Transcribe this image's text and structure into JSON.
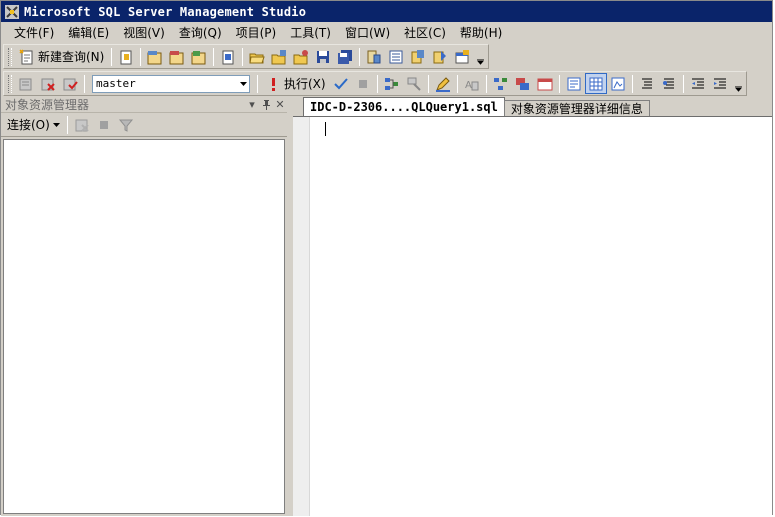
{
  "window": {
    "title": "Microsoft SQL Server Management Studio"
  },
  "menu": [
    {
      "label": "文件(F)",
      "name": "menu-file"
    },
    {
      "label": "编辑(E)",
      "name": "menu-edit"
    },
    {
      "label": "视图(V)",
      "name": "menu-view"
    },
    {
      "label": "查询(Q)",
      "name": "menu-query"
    },
    {
      "label": "项目(P)",
      "name": "menu-project"
    },
    {
      "label": "工具(T)",
      "name": "menu-tools"
    },
    {
      "label": "窗口(W)",
      "name": "menu-window"
    },
    {
      "label": "社区(C)",
      "name": "menu-community"
    },
    {
      "label": "帮助(H)",
      "name": "menu-help"
    }
  ],
  "toolbar1": {
    "new_query_label": "新建查询(N)"
  },
  "toolbar2": {
    "database": "master",
    "execute_label": "执行(X)"
  },
  "object_explorer": {
    "title": "对象资源管理器",
    "connect_label": "连接(O)",
    "pin_glyph": "ᵖ",
    "close_glyph": "✕",
    "dropdown_glyph": "▾"
  },
  "tabs": [
    {
      "label": "IDC-D-2306....QLQuery1.sql",
      "active": true
    },
    {
      "label": "对象资源管理器详细信息",
      "active": false
    }
  ],
  "colors": {
    "titlebar": "#0a246a",
    "chrome": "#d4d0c8"
  }
}
